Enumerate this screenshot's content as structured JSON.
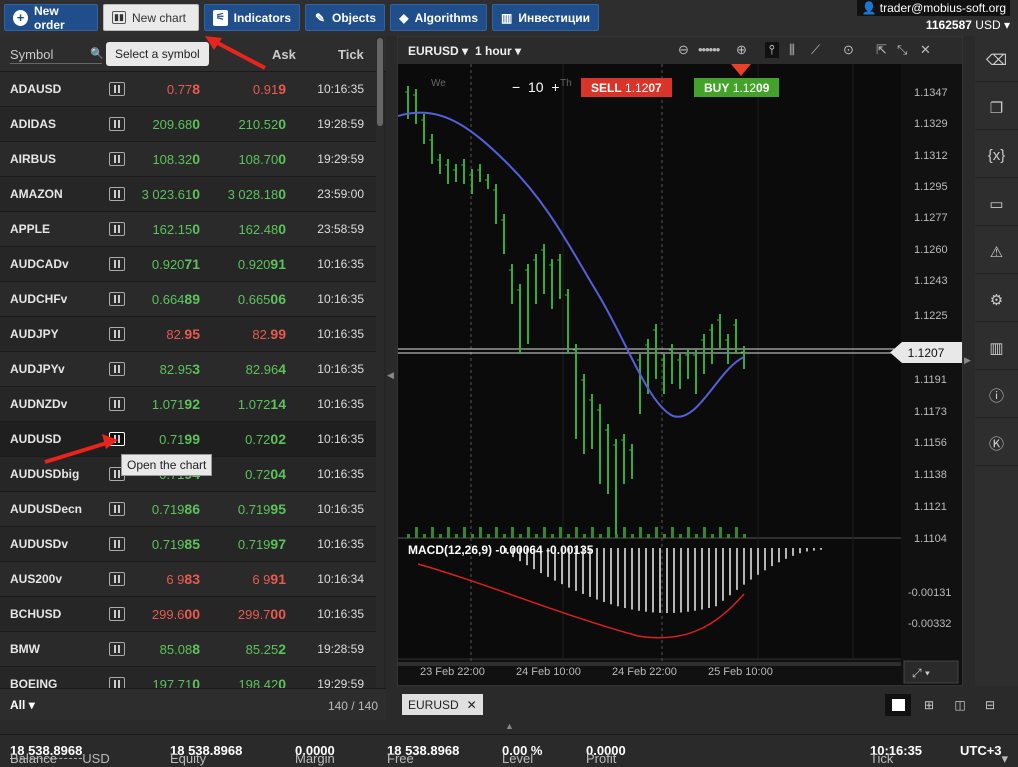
{
  "toolbar": {
    "new_order": "New order",
    "new_chart": "New chart",
    "indicators": "Indicators",
    "objects": "Objects",
    "algorithms": "Algorithms",
    "investments": "Инвестиции"
  },
  "account": {
    "email": "trader@mobius-soft.org",
    "id": "1162587",
    "currency": "USD"
  },
  "symbols_panel": {
    "col_symbol": "Symbol",
    "col_ask": "Ask",
    "col_tick": "Tick",
    "select_tooltip": "Select a symbol",
    "open_chart_tooltip": "Open the chart",
    "filter": "All",
    "count": "140 / 140",
    "rows": [
      {
        "sym": "ADAUSD",
        "bid_a": "0.77",
        "bid_b": "8",
        "ask_a": "0.91",
        "ask_b": "9",
        "tick": "10:16:35",
        "dir": "dn"
      },
      {
        "sym": "ADIDAS",
        "bid_a": "209.68",
        "bid_b": "0",
        "ask_a": "210.52",
        "ask_b": "0",
        "tick": "19:28:59",
        "dir": "up"
      },
      {
        "sym": "AIRBUS",
        "bid_a": "108.32",
        "bid_b": "0",
        "ask_a": "108.70",
        "ask_b": "0",
        "tick": "19:29:59",
        "dir": "up"
      },
      {
        "sym": "AMAZON",
        "bid_a": "3 023.61",
        "bid_b": "0",
        "ask_a": "3 028.18",
        "ask_b": "0",
        "tick": "23:59:00",
        "dir": "up"
      },
      {
        "sym": "APPLE",
        "bid_a": "162.15",
        "bid_b": "0",
        "ask_a": "162.48",
        "ask_b": "0",
        "tick": "23:58:59",
        "dir": "up"
      },
      {
        "sym": "AUDCADv",
        "bid_a": "0.920",
        "bid_b": "71",
        "ask_a": "0.920",
        "ask_b": "91",
        "tick": "10:16:35",
        "dir": "up"
      },
      {
        "sym": "AUDCHFv",
        "bid_a": "0.664",
        "bid_b": "89",
        "ask_a": "0.665",
        "ask_b": "06",
        "tick": "10:16:35",
        "dir": "up"
      },
      {
        "sym": "AUDJPY",
        "bid_a": "82.",
        "bid_b": "95",
        "ask_a": "82.",
        "ask_b": "99",
        "tick": "10:16:35",
        "dir": "dn"
      },
      {
        "sym": "AUDJPYv",
        "bid_a": "82.95",
        "bid_b": "3",
        "ask_a": "82.96",
        "ask_b": "4",
        "tick": "10:16:35",
        "dir": "up"
      },
      {
        "sym": "AUDNZDv",
        "bid_a": "1.071",
        "bid_b": "92",
        "ask_a": "1.072",
        "ask_b": "14",
        "tick": "10:16:35",
        "dir": "up"
      },
      {
        "sym": "AUDUSD",
        "bid_a": "0.71",
        "bid_b": "99",
        "ask_a": "0.72",
        "ask_b": "02",
        "tick": "10:16:35",
        "dir": "up"
      },
      {
        "sym": "AUDUSDbig",
        "bid_a": "0.71",
        "bid_b": "94",
        "ask_a": "0.72",
        "ask_b": "04",
        "tick": "10:16:35",
        "dir": "up"
      },
      {
        "sym": "AUDUSDecn",
        "bid_a": "0.719",
        "bid_b": "86",
        "ask_a": "0.719",
        "ask_b": "95",
        "tick": "10:16:35",
        "dir": "up"
      },
      {
        "sym": "AUDUSDv",
        "bid_a": "0.719",
        "bid_b": "85",
        "ask_a": "0.719",
        "ask_b": "97",
        "tick": "10:16:35",
        "dir": "up"
      },
      {
        "sym": "AUS200v",
        "bid_a": "6 9",
        "bid_b": "83",
        "ask_a": "6 9",
        "ask_b": "91",
        "tick": "10:16:34",
        "dir": "dn"
      },
      {
        "sym": "BCHUSD",
        "bid_a": "299.6",
        "bid_b": "00",
        "ask_a": "299.7",
        "ask_b": "00",
        "tick": "10:16:35",
        "dir": "dn"
      },
      {
        "sym": "BMW",
        "bid_a": "85.08",
        "bid_b": "8",
        "ask_a": "85.25",
        "ask_b": "2",
        "tick": "19:28:59",
        "dir": "up"
      },
      {
        "sym": "BOEING",
        "bid_a": "197.71",
        "bid_b": "0",
        "ask_a": "198.42",
        "ask_b": "0",
        "tick": "19:29:59",
        "dir": "up"
      }
    ]
  },
  "chart": {
    "symbol": "EURUSD",
    "timeframe": "1 hour",
    "quantity": "10",
    "sell_label": "SELL",
    "sell_price_a": "1.12",
    "sell_price_b": "07",
    "buy_label": "BUY",
    "buy_price_a": "1.12",
    "buy_price_b": "09",
    "current_price": "1.1207",
    "day_label_we": "We",
    "day_label_th": "Th",
    "price_ticks": [
      "1.1347",
      "1.1329",
      "1.1312",
      "1.1295",
      "1.1277",
      "1.1260",
      "1.1243",
      "1.1225",
      "1.1191",
      "1.1173",
      "1.1156",
      "1.1138",
      "1.1121",
      "1.1104"
    ],
    "macd_label": "MACD(12,26,9) -0.00064 -0.00135",
    "macd_ticks": [
      "-0.00131",
      "-0.00332"
    ],
    "time_ticks": [
      "23 Feb 22:00",
      "24 Feb 10:00",
      "24 Feb 22:00",
      "25 Feb 10:00"
    ],
    "tab": "EURUSD"
  },
  "status": {
    "balance_label": "Balance",
    "balance": "18 538.8968",
    "balance_cur": "USD",
    "equity_label": "Equity",
    "equity": "18 538.8968",
    "margin_label": "Margin",
    "margin": "0.0000",
    "free_label": "Free",
    "free": "18 538.8968",
    "level_label": "Level",
    "level": "0.00 %",
    "profit_label": "Profit",
    "profit": "0.0000",
    "tick_label": "Tick",
    "tick": "10:16:35",
    "tz": "UTC+3"
  },
  "colors": {
    "accent": "#1f4e8a",
    "up": "#5cc25c",
    "down": "#e85a4f",
    "sell": "#d8342a",
    "buy": "#44a12a"
  }
}
